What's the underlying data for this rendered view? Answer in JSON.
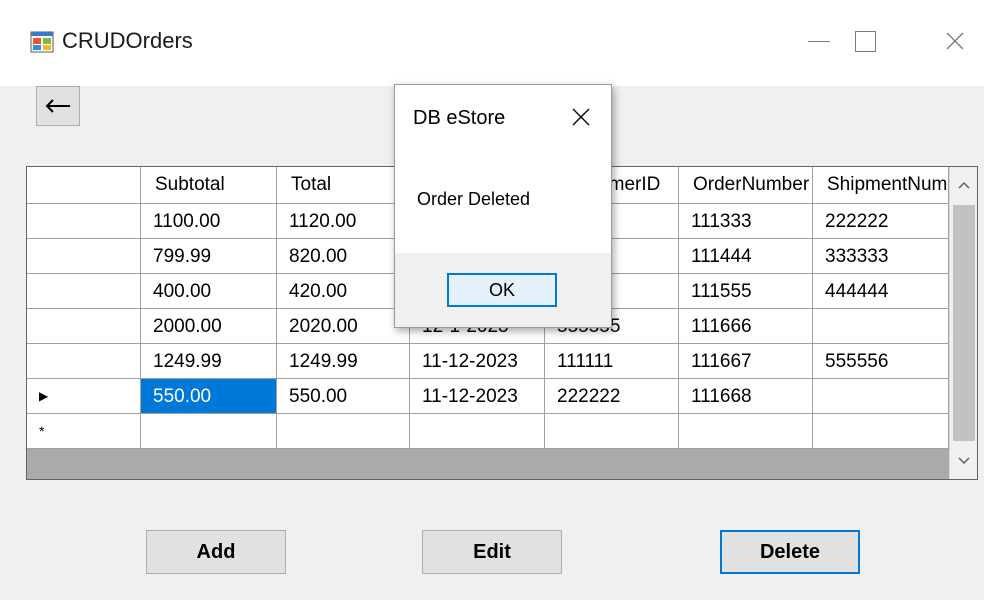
{
  "window": {
    "title": "CRUDOrders",
    "icon": "windows-forms-app-icon",
    "controls": [
      "minimize-icon",
      "maximize-icon",
      "close-icon"
    ]
  },
  "back_button": {
    "icon": "arrow-left-icon",
    "label": "←"
  },
  "grid": {
    "columns": [
      "",
      "Subtotal",
      "Total",
      "",
      "CustomerID",
      "OrderNumber",
      "ShipmentNum"
    ],
    "rows": [
      {
        "indicator": "",
        "cells": [
          "1100.00",
          "1120.00",
          "",
          "",
          "111333",
          "222222"
        ]
      },
      {
        "indicator": "",
        "cells": [
          "799.99",
          "820.00",
          "",
          "",
          "111444",
          "333333"
        ]
      },
      {
        "indicator": "",
        "cells": [
          "400.00",
          "420.00",
          "",
          "",
          "111555",
          "444444"
        ]
      },
      {
        "indicator": "",
        "cells": [
          "2000.00",
          "2020.00",
          "12-1-2023",
          "555555",
          "111666",
          ""
        ]
      },
      {
        "indicator": "",
        "cells": [
          "1249.99",
          "1249.99",
          "11-12-2023",
          "111111",
          "111667",
          "555556"
        ]
      },
      {
        "indicator": "▶",
        "cells": [
          "550.00",
          "550.00",
          "11-12-2023",
          "222222",
          "111668",
          ""
        ]
      },
      {
        "indicator": "*",
        "cells": [
          "",
          "",
          "",
          "",
          "",
          ""
        ]
      }
    ],
    "selected": {
      "row": 5,
      "col": 0
    },
    "selection_color": "#0078d7"
  },
  "buttons": {
    "add": "Add",
    "edit": "Edit",
    "delete": "Delete"
  },
  "dialog": {
    "title": "DB eStore",
    "message": "Order Deleted",
    "ok_label": "OK"
  },
  "colors": {
    "accent": "#0078d7",
    "window_bg": "#f0f0f0",
    "grid_bg": "#aaaaaa"
  }
}
